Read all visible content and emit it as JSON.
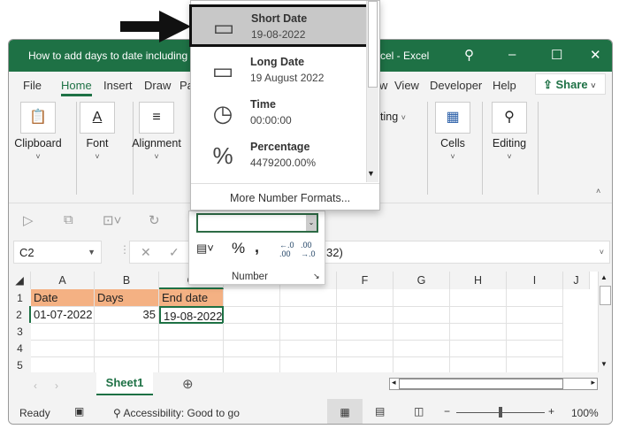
{
  "window": {
    "title": "How to add days to date including d",
    "title_suffix": "xcel  -  Excel"
  },
  "menu": [
    "File",
    "Home",
    "Insert",
    "Draw",
    "Pag",
    "w",
    "View",
    "Developer",
    "Help"
  ],
  "share_label": "Share",
  "ribbon": {
    "groups": [
      "Clipboard",
      "Font",
      "Alignment",
      "Cells",
      "Editing"
    ],
    "partial_group": "ting"
  },
  "number_formats": [
    {
      "name": "Short Date",
      "example": "19-08-2022",
      "icon": "calendar-icon",
      "selected": true
    },
    {
      "name": "Long Date",
      "example": "19 August 2022",
      "icon": "calendar-icon"
    },
    {
      "name": "Time",
      "example": "00:00:00",
      "icon": "clock-icon"
    },
    {
      "name": "Percentage",
      "example": "4479200.00%",
      "icon": "percent-icon"
    }
  ],
  "more_formats": "More Number Formats...",
  "number_group": {
    "label": "Number",
    "format_value": ""
  },
  "formula_bar": {
    "name_box": "C2",
    "formula_tail": "32)"
  },
  "columns": [
    "A",
    "B",
    "C",
    "D",
    "E",
    "F",
    "G",
    "H",
    "I",
    "J"
  ],
  "rows": [
    {
      "num": "1",
      "cells": [
        "Date",
        "Days",
        "End date"
      ]
    },
    {
      "num": "2",
      "cells": [
        "01-07-2022",
        "35",
        "19-08-2022"
      ]
    },
    {
      "num": "3",
      "cells": [
        "",
        "",
        ""
      ]
    },
    {
      "num": "4",
      "cells": [
        "",
        "",
        ""
      ]
    },
    {
      "num": "5",
      "cells": [
        "",
        "",
        ""
      ]
    }
  ],
  "sheet_tab": "Sheet1",
  "status": {
    "ready": "Ready",
    "accessibility": "Accessibility: Good to go",
    "zoom": "100%",
    "zoom_level": 100
  },
  "colors": {
    "brand": "#1e7145",
    "header_fill": "#f4b183",
    "highlight": "#c8c8c8"
  }
}
